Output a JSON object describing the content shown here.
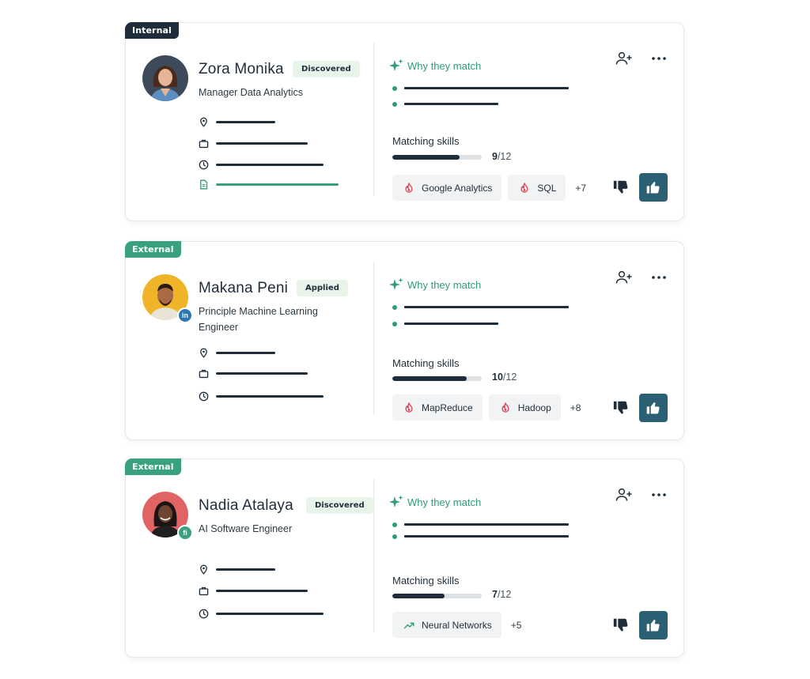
{
  "colors": {
    "internal_tag": "#1f2d3a",
    "external_tag": "#3aa17e",
    "accent_green": "#2f9c76",
    "status_bg": "#e6f4ea",
    "primary_button": "#2b5f73",
    "text_dark": "#1f2d3a",
    "fire_red": "#d94154"
  },
  "candidates": [
    {
      "source_tag": "Internal",
      "name": "Zora Monika",
      "status": "Discovered",
      "title": "Manager Data Analytics",
      "avatar_bg": "#3c4a59",
      "source_logo": "",
      "info_icons": [
        "location-pin-icon",
        "briefcase-icon",
        "clock-icon",
        "document-icon"
      ],
      "why_match_label": "Why they match",
      "matching_skills_label": "Matching skills",
      "match_count": "9",
      "match_total": "/12",
      "match_fraction": 0.75,
      "skills": [
        {
          "icon": "fire-icon",
          "label": "Google Analytics"
        },
        {
          "icon": "fire-icon",
          "label": "SQL"
        }
      ],
      "more_skills": "+7"
    },
    {
      "source_tag": "External",
      "name": "Makana Peni",
      "status": "Applied",
      "title": "Principle Machine Learning Engineer",
      "avatar_bg": "#f0b429",
      "source_logo": "in",
      "info_icons": [
        "location-pin-icon",
        "briefcase-icon",
        "clock-icon"
      ],
      "why_match_label": "Why they match",
      "matching_skills_label": "Matching skills",
      "match_count": "10",
      "match_total": "/12",
      "match_fraction": 0.83,
      "skills": [
        {
          "icon": "fire-icon",
          "label": "MapReduce"
        },
        {
          "icon": "fire-icon",
          "label": "Hadoop"
        }
      ],
      "more_skills": "+8"
    },
    {
      "source_tag": "External",
      "name": "Nadia Atalaya",
      "status": "Discovered",
      "title": "AI Software Engineer",
      "avatar_bg": "#e06464",
      "source_logo": "fi",
      "info_icons": [
        "location-pin-icon",
        "briefcase-icon",
        "clock-icon"
      ],
      "why_match_label": "Why they match",
      "matching_skills_label": "Matching skills",
      "match_count": "7",
      "match_total": "/12",
      "match_fraction": 0.58,
      "skills": [
        {
          "icon": "trending-up-icon",
          "label": "Neural Networks"
        }
      ],
      "more_skills": "+5"
    }
  ]
}
